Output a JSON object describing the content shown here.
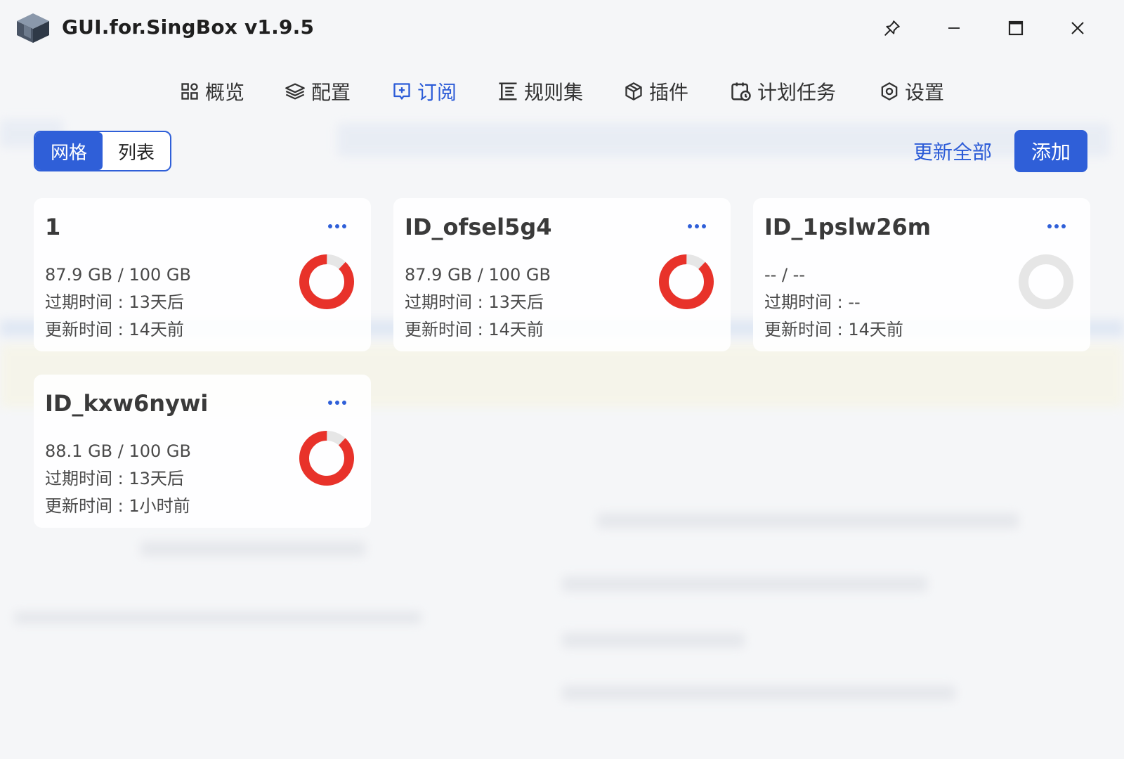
{
  "window": {
    "title": "GUI.for.SingBox v1.9.5"
  },
  "nav": {
    "items": [
      {
        "label": "概览",
        "icon": "dashboard-icon"
      },
      {
        "label": "配置",
        "icon": "layers-icon"
      },
      {
        "label": "订阅",
        "icon": "add-box-icon",
        "active": true
      },
      {
        "label": "规则集",
        "icon": "ruleset-icon"
      },
      {
        "label": "插件",
        "icon": "package-icon"
      },
      {
        "label": "计划任务",
        "icon": "calendar-clock-icon"
      },
      {
        "label": "设置",
        "icon": "settings-icon"
      }
    ]
  },
  "toolbar": {
    "view_grid": "网格",
    "view_list": "列表",
    "active_view": "网格",
    "update_all": "更新全部",
    "add": "添加"
  },
  "colors": {
    "accent": "#2f5fd8",
    "usage_red": "#e8322a",
    "track_gray": "#e6e6e6"
  },
  "subscriptions": [
    {
      "name": "1",
      "traffic": "87.9 GB / 100 GB",
      "expire": "过期时间 : 13天后",
      "updated": "更新时间 : 14天前",
      "usage": 0.879
    },
    {
      "name": "ID_ofsel5g4",
      "traffic": "87.9 GB / 100 GB",
      "expire": "过期时间 : 13天后",
      "updated": "更新时间 : 14天前",
      "usage": 0.879
    },
    {
      "name": "ID_1pslw26m",
      "traffic": "-- / --",
      "expire": "过期时间 : --",
      "updated": "更新时间 : 14天前",
      "usage": 0
    },
    {
      "name": "ID_kxw6nywi",
      "traffic": "88.1 GB / 100 GB",
      "expire": "过期时间 : 13天后",
      "updated": "更新时间 : 1小时前",
      "usage": 0.881
    }
  ]
}
